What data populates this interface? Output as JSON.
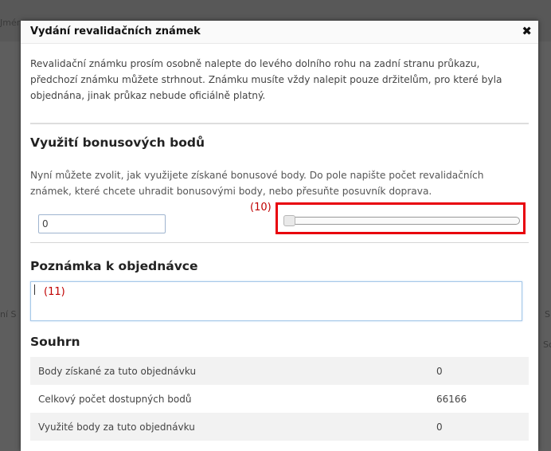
{
  "background": {
    "partial_left_top": "Jméno",
    "partial_left_mid": "ní S",
    "partial_right_mid": "S",
    "partial_right_low": "Sc"
  },
  "modal": {
    "title": "Vydání revalidačních známek",
    "close_glyph": "✖",
    "intro": "Revalidační známku prosím osobně nalepte do levého dolního rohu na zadní stranu průkazu, předchozí známku můžete strhnout. Známku musíte vždy nalepit pouze držitelům, pro které byla objednána, jinak průkaz nebude oficiálně platný."
  },
  "bonus": {
    "heading": "Využití bonusových bodů",
    "description": "Nyní můžete zvolit, jak využijete získané bonusové body. Do pole napište počet revalidačních známek, které chcete uhradit bonusovými body, nebo přesuňte posuvník doprava.",
    "input_value": "0",
    "slider_value": 0,
    "slider_annotation": "(10)"
  },
  "note": {
    "heading": "Poznámka k objednávce",
    "value": "",
    "annotation": "(11)"
  },
  "summary": {
    "heading": "Souhrn",
    "rows": [
      {
        "label": "Body získané za tuto objednávku",
        "value": "0"
      },
      {
        "label": "Celkový počet dostupných bodů",
        "value": "66166"
      },
      {
        "label": "Využité body za tuto objednávku",
        "value": "0"
      }
    ]
  },
  "colors": {
    "annotation_red": "#e8000c",
    "overlay": "#5e5e5e"
  }
}
